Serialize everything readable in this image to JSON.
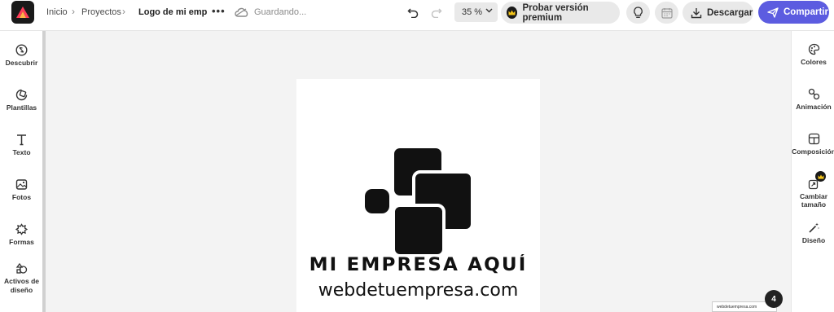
{
  "header": {
    "breadcrumb": {
      "home": "Inicio",
      "projects": "Proyectos"
    },
    "doc_title": "Logo de mi emp",
    "more": "•••",
    "saving_status": "Guardando...",
    "zoom": "35 %",
    "premium_label": "Probar versión premium",
    "download_label": "Descargar",
    "share_label": "Compartir"
  },
  "left_sidebar": {
    "items": [
      {
        "label": "Descubrir",
        "icon": "compass-icon"
      },
      {
        "label": "Plantillas",
        "icon": "templates-icon"
      },
      {
        "label": "Texto",
        "icon": "text-icon"
      },
      {
        "label": "Fotos",
        "icon": "photo-icon"
      },
      {
        "label": "Formas",
        "icon": "shapes-icon"
      },
      {
        "label": "Activos de diseño",
        "icon": "assets-icon"
      }
    ]
  },
  "right_sidebar": {
    "items": [
      {
        "label": "Colores",
        "icon": "palette-icon"
      },
      {
        "label": "Animación",
        "icon": "animation-icon"
      },
      {
        "label": "Composición",
        "icon": "layout-icon"
      },
      {
        "label": "Cambiar tamaño",
        "icon": "resize-icon"
      },
      {
        "label": "Diseño",
        "icon": "magic-wand-icon"
      }
    ]
  },
  "canvas": {
    "company_name": "MI EMPRESA AQUÍ",
    "company_web": "webdetuempresa.com"
  },
  "footer": {
    "page_count": "4",
    "thumb_text": "webdetuempresa.com"
  },
  "colors": {
    "accent": "#5c5ce0",
    "bar_bg": "#ffffff",
    "canvas_bg": "#f3f3f3",
    "button_bg": "#e9e9e9"
  }
}
